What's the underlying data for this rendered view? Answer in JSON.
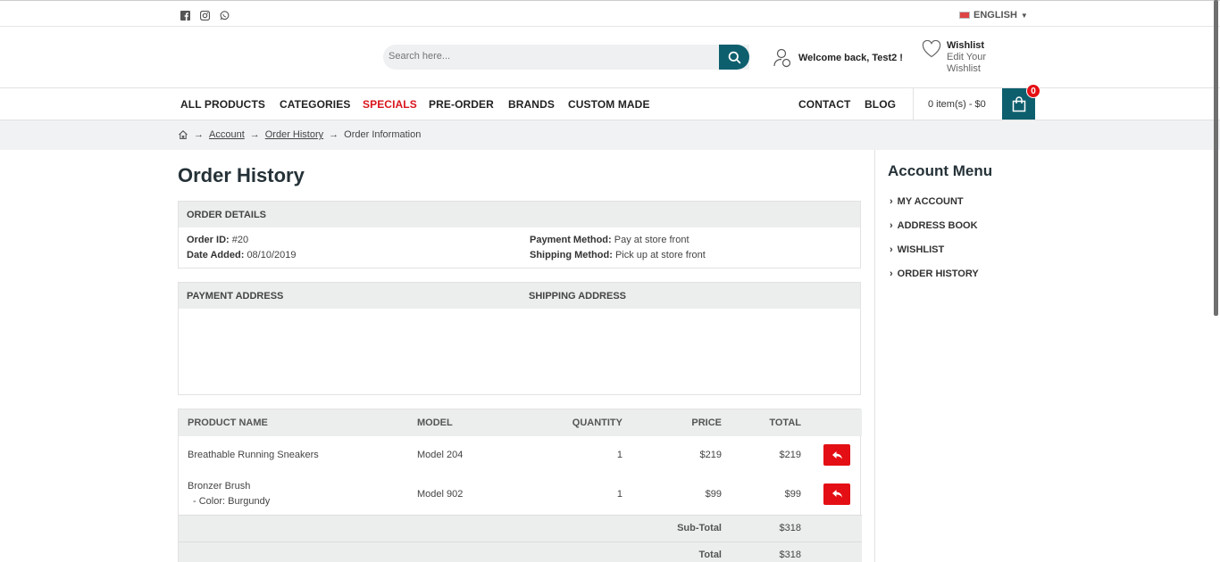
{
  "topbar": {
    "social_icons": [
      "facebook-icon",
      "instagram-icon",
      "whatsapp-icon"
    ],
    "language": "ENGLISH"
  },
  "header": {
    "search_placeholder": "Search here...",
    "welcome": "Welcome back, Test2 !",
    "wishlist_title": "Wishlist",
    "wishlist_sub": "Edit Your Wishlist"
  },
  "nav": {
    "items": [
      "ALL PRODUCTS",
      "CATEGORIES",
      "SPECIALS",
      "PRE-ORDER",
      "BRANDS",
      "CUSTOM MADE"
    ],
    "right_items": [
      "CONTACT",
      "BLOG"
    ],
    "cart_text": "0 item(s) - $0",
    "cart_count": "0"
  },
  "breadcrumb": {
    "items": [
      "Account",
      "Order History",
      "Order Information"
    ],
    "separator": "→"
  },
  "page_title": "Order History",
  "order_details": {
    "heading": "ORDER DETAILS",
    "order_id_label": "Order ID:",
    "order_id": "#20",
    "date_label": "Date Added:",
    "date": "08/10/2019",
    "payment_label": "Payment Method:",
    "payment": "Pay at store front",
    "shipping_label": "Shipping Method:",
    "shipping": "Pick up at store front"
  },
  "addresses": {
    "payment_heading": "PAYMENT ADDRESS",
    "shipping_heading": "SHIPPING ADDRESS"
  },
  "products": {
    "headers": [
      "PRODUCT NAME",
      "MODEL",
      "QUANTITY",
      "PRICE",
      "TOTAL"
    ],
    "rows": [
      {
        "name": "Breathable Running Sneakers",
        "option": "",
        "model": "Model 204",
        "qty": "1",
        "price": "$219",
        "total": "$219"
      },
      {
        "name": "Bronzer Brush",
        "option": "- Color: Burgundy",
        "model": "Model 902",
        "qty": "1",
        "price": "$99",
        "total": "$99"
      }
    ],
    "subtotal_label": "Sub-Total",
    "subtotal": "$318",
    "total_label": "Total",
    "total": "$318"
  },
  "account_menu": {
    "title": "Account Menu",
    "items": [
      "MY ACCOUNT",
      "ADDRESS BOOK",
      "WISHLIST",
      "ORDER HISTORY"
    ]
  },
  "colors": {
    "accent": "#0e5f6e",
    "red": "#e40f14",
    "specials": "#d9151c"
  }
}
